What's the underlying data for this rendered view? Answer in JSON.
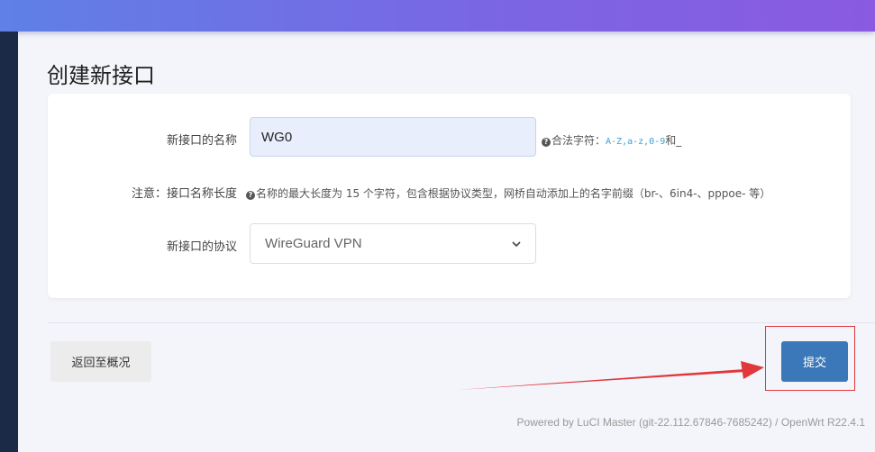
{
  "page": {
    "title": "创建新接口"
  },
  "form": {
    "name_label": "新接口的名称",
    "name_value": "WG0",
    "name_help_prefix": "合法字符：",
    "name_help_chars": "A-Z,a-z,0-9",
    "name_help_suffix": "和_",
    "note_label": "注意：接口名称长度",
    "note_text": "名称的最大长度为 15 个字符，包含根据协议类型，网桥自动添加上的名字前缀（br-、6in4-、pppoe- 等）",
    "protocol_label": "新接口的协议",
    "protocol_value": "WireGuard VPN"
  },
  "actions": {
    "back_label": "返回至概况",
    "submit_label": "提交"
  },
  "footer": {
    "text": "Powered by LuCI Master (git-22.112.67846-7685242) / OpenWrt R22.4.1"
  },
  "colors": {
    "accent": "#3a78b9",
    "annotation": "#e0383b"
  },
  "icons": {
    "help": "question-circle-icon",
    "select": "chevron-down-icon"
  }
}
